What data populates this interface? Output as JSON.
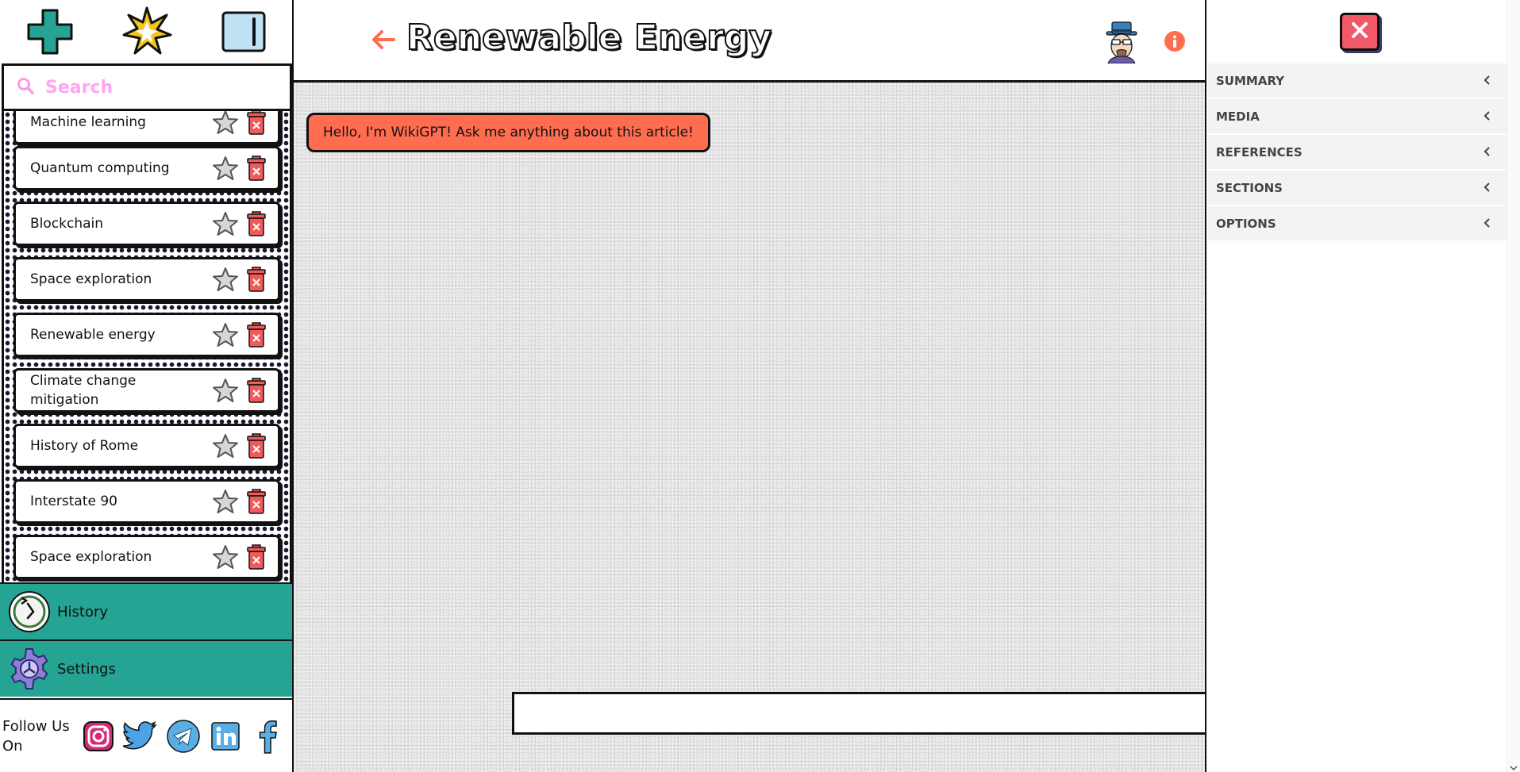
{
  "sidebar": {
    "top_icons": {
      "new": "plus-icon",
      "spark": "sparkle-icon",
      "toggle": "sidebar-toggle-icon"
    },
    "search": {
      "placeholder": "Search",
      "value": ""
    },
    "articles": [
      {
        "title": "Machine learning"
      },
      {
        "title": "Quantum computing"
      },
      {
        "title": "Blockchain"
      },
      {
        "title": "Space exploration"
      },
      {
        "title": "Renewable energy"
      },
      {
        "title": "Climate change mitigation"
      },
      {
        "title": "History of Rome"
      },
      {
        "title": "Interstate 90"
      },
      {
        "title": "Space exploration"
      }
    ],
    "nav": {
      "history_label": "History",
      "settings_label": "Settings"
    },
    "follow_label": "Follow Us On",
    "socials": [
      "instagram-icon",
      "twitter-icon",
      "telegram-icon",
      "linkedin-icon",
      "facebook-icon"
    ]
  },
  "header": {
    "title": "Renewable Energy"
  },
  "chat": {
    "bot_message": "Hello, I'm WikiGPT! Ask me anything about this article!",
    "input_value": "",
    "input_placeholder": ""
  },
  "right_panel": {
    "sections": [
      {
        "label": "SUMMARY"
      },
      {
        "label": "MEDIA"
      },
      {
        "label": "REFERENCES"
      },
      {
        "label": "SECTIONS"
      },
      {
        "label": "OPTIONS"
      }
    ]
  },
  "colors": {
    "accent_orange": "#ff6d50",
    "teal": "#25a493",
    "delete_red": "#ef5a5a",
    "close_red": "#f0596a",
    "search_pink": "#ff99e6"
  }
}
